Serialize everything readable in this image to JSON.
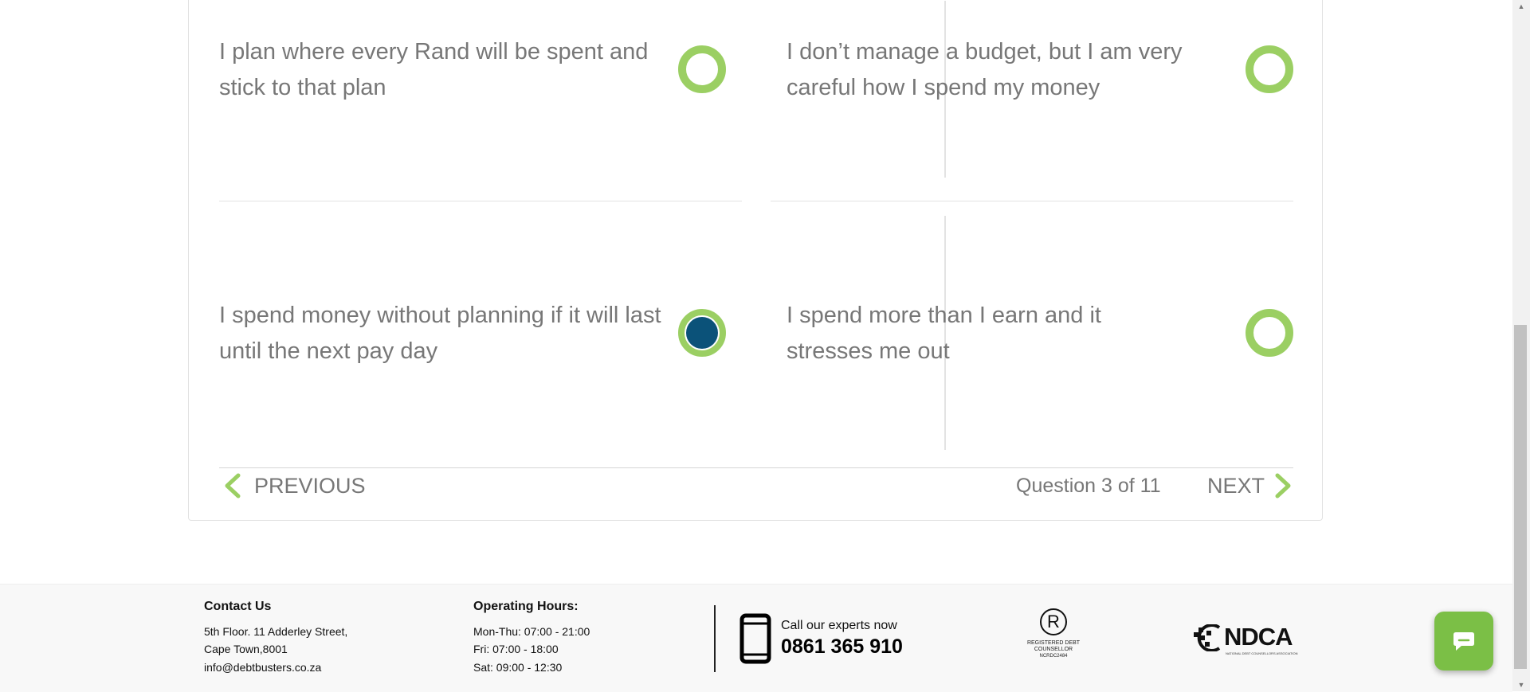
{
  "quiz": {
    "options": [
      {
        "text": "I plan where every Rand will be spent and stick to that plan",
        "selected": false
      },
      {
        "text": "I don’t manage a budget, but I am very careful how I spend my money",
        "selected": false
      },
      {
        "text": "I spend money without planning if it will last until the next pay day",
        "selected": true
      },
      {
        "text": "I spend more than I earn and it stresses me out",
        "selected": false
      }
    ],
    "previous_label": "PREVIOUS",
    "next_label": "NEXT",
    "question_counter": "Question 3 of 11"
  },
  "footer": {
    "contact": {
      "title": "Contact Us",
      "address_line1": "5th Floor. 11 Adderley Street,",
      "address_line2": "Cape Town,8001",
      "email": "info@debtbusters.co.za"
    },
    "hours": {
      "title": "Operating Hours:",
      "mon_thu": "Mon-Thu: 07:00 - 21:00",
      "fri": "Fri: 07:00 - 18:00",
      "sat": "Sat: 09:00 - 12:30"
    },
    "call": {
      "label": "Call our experts now",
      "number": "0861 365 910"
    },
    "ncr_badge": {
      "symbol": "R",
      "line1": "REGISTERED DEBT",
      "line2": "COUNSELLOR",
      "line3": "NCRDC2484"
    },
    "ndca_logo": {
      "text": "NDCA",
      "subtext": "NATIONAL DEBT COUNSELLORS ASSOCIATION"
    }
  },
  "colors": {
    "accent_green": "#9bcf63",
    "selected_blue": "#0b5279",
    "chat_green": "#7bbf46"
  },
  "icons": {
    "previous": "chevron-left-icon",
    "next": "chevron-right-icon",
    "phone": "phone-icon",
    "chat": "chat-icon"
  }
}
